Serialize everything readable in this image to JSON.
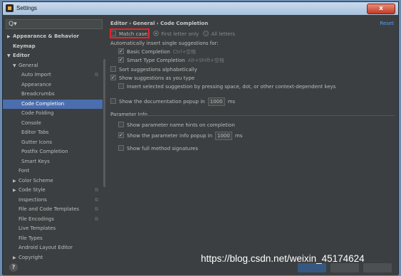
{
  "window": {
    "title": "Settings",
    "close_label": "x"
  },
  "sidebar": {
    "search_icon": "Q▾",
    "items": [
      {
        "label": "Appearance & Behavior",
        "level": 0,
        "arrow": "▶",
        "bold": true
      },
      {
        "label": "Keymap",
        "level": 0,
        "arrow": "",
        "bold": true
      },
      {
        "label": "Editor",
        "level": 0,
        "arrow": "▼",
        "bold": true
      },
      {
        "label": "General",
        "level": 1,
        "arrow": "▼"
      },
      {
        "label": "Auto Import",
        "level": 2,
        "copy": true
      },
      {
        "label": "Appearance",
        "level": 2
      },
      {
        "label": "Breadcrumbs",
        "level": 2
      },
      {
        "label": "Code Completion",
        "level": 2,
        "selected": true
      },
      {
        "label": "Code Folding",
        "level": 2
      },
      {
        "label": "Console",
        "level": 2
      },
      {
        "label": "Editor Tabs",
        "level": 2
      },
      {
        "label": "Gutter Icons",
        "level": 2
      },
      {
        "label": "Postfix Completion",
        "level": 2
      },
      {
        "label": "Smart Keys",
        "level": 2
      },
      {
        "label": "Font",
        "level": 1
      },
      {
        "label": "Color Scheme",
        "level": 1,
        "arrow": "▶"
      },
      {
        "label": "Code Style",
        "level": 1,
        "arrow": "▶",
        "copy": true
      },
      {
        "label": "Inspections",
        "level": 1,
        "copy": true
      },
      {
        "label": "File and Code Templates",
        "level": 1,
        "copy": true
      },
      {
        "label": "File Encodings",
        "level": 1,
        "copy": true
      },
      {
        "label": "Live Templates",
        "level": 1
      },
      {
        "label": "File Types",
        "level": 1
      },
      {
        "label": "Android Layout Editor",
        "level": 1
      },
      {
        "label": "Copyright",
        "level": 1,
        "arrow": "▶"
      }
    ]
  },
  "content": {
    "breadcrumb": "Editor  ›  General  ›  Code Completion",
    "reset": "Reset",
    "match_case": "Match case:",
    "first_letter_only": "First letter only",
    "all_letters": "All letters",
    "auto_insert": "Automatically insert single suggestions for:",
    "basic_completion": "Basic Completion",
    "basic_shortcut": "Ctrl+空格",
    "smart_completion": "Smart Type Completion",
    "smart_shortcut": "Alt+Shift+空格",
    "sort_alpha": "Sort suggestions alphabetically",
    "show_as_you_type": "Show suggestions as you type",
    "insert_selected": "Insert selected suggestion by pressing space, dot, or other context-dependent keys",
    "show_doc_popup": "Show the documentation popup in",
    "doc_popup_ms": "1000",
    "ms": "ms",
    "param_info_title": "Parameter Info",
    "param_hints": "Show parameter name hints on completion",
    "param_popup": "Show the parameter info popup in",
    "param_popup_ms": "1000",
    "full_signatures": "Show full method signatures"
  },
  "bottom": {
    "help": "?"
  },
  "watermark": "https://blog.csdn.net/weixin_45174624"
}
